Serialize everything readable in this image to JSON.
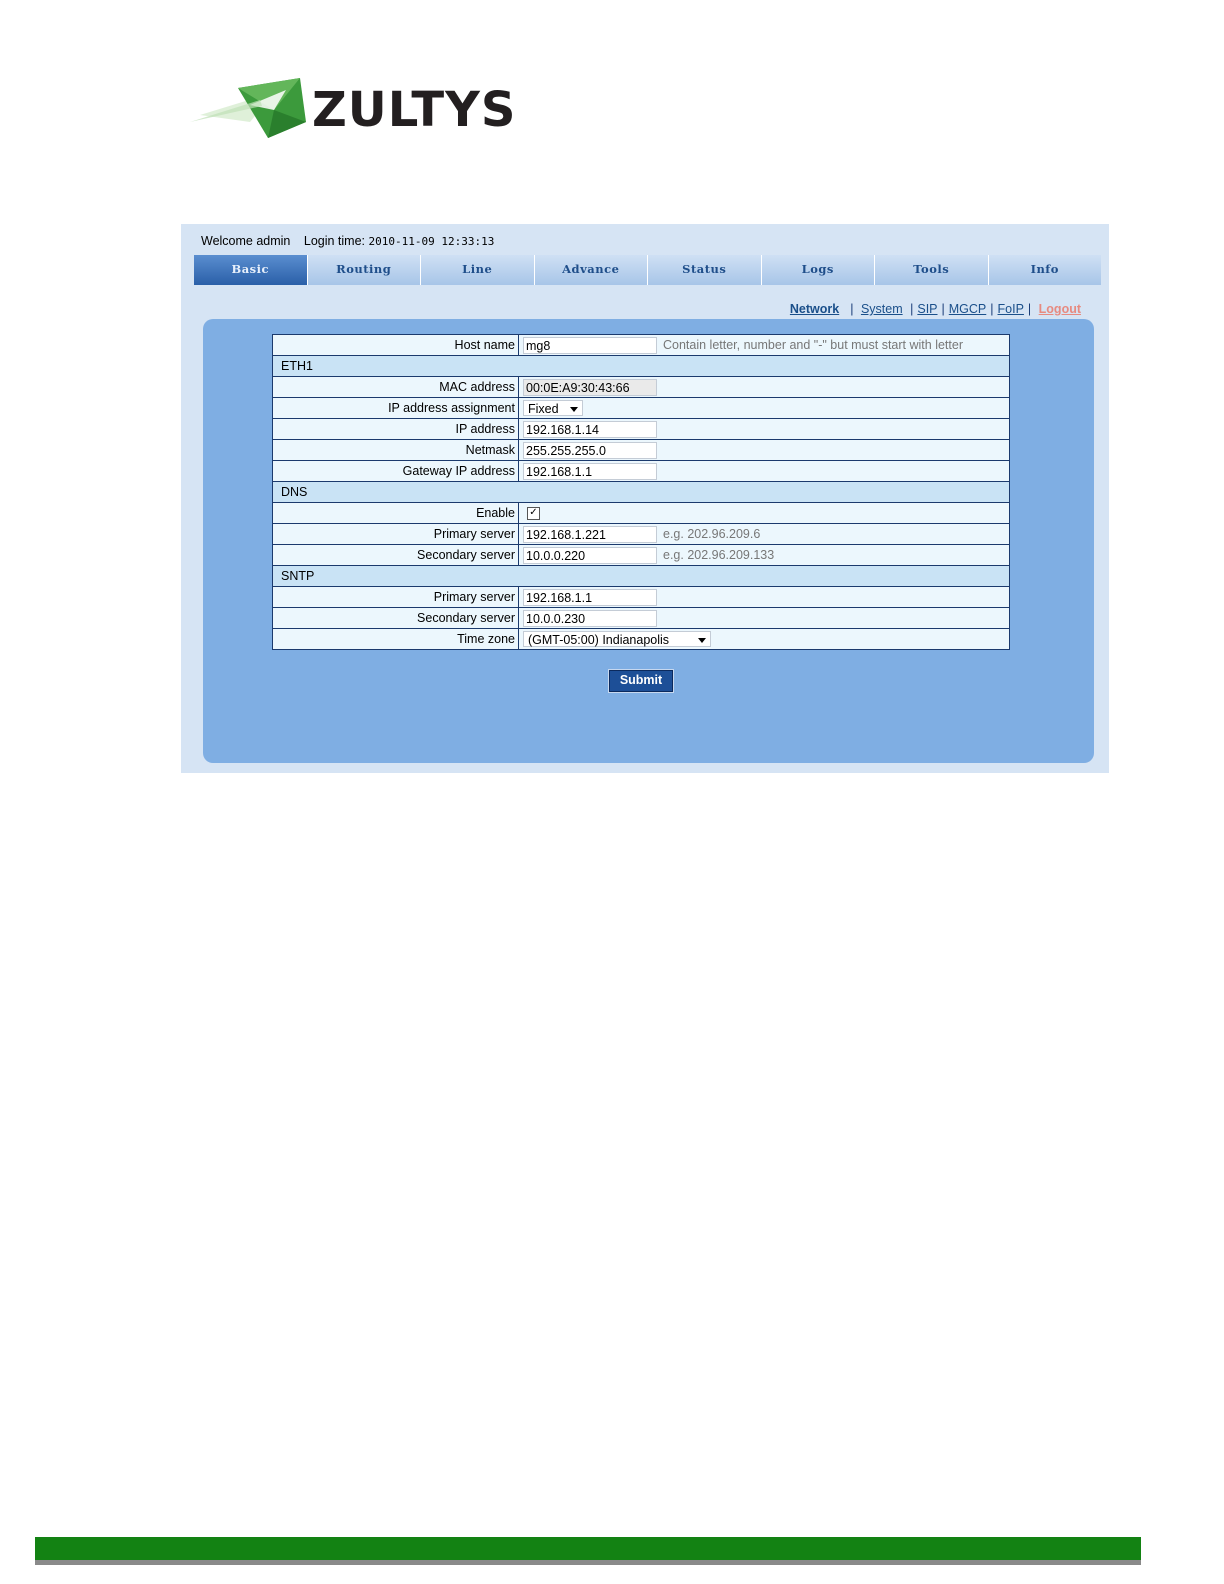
{
  "logo": {
    "text": "ZULTYS",
    "icon": "zultys-leaf-logo"
  },
  "header": {
    "welcome_label": "Welcome admin",
    "login_label": "Login time:",
    "login_time": "2010-11-09 12:33:13"
  },
  "tabs": [
    {
      "label": "Basic",
      "active": true
    },
    {
      "label": "Routing"
    },
    {
      "label": "Line"
    },
    {
      "label": "Advance"
    },
    {
      "label": "Status"
    },
    {
      "label": "Logs"
    },
    {
      "label": "Tools"
    },
    {
      "label": "Info"
    }
  ],
  "subnav": {
    "network": "Network",
    "system": "System",
    "sip": "SIP",
    "mgcp": "MGCP",
    "foip": "FoIP",
    "logout": "Logout"
  },
  "form": {
    "host_name": {
      "label": "Host name",
      "value": "mg8",
      "hint": "Contain letter, number and \"-\" but must start with letter"
    },
    "eth1": {
      "title": "ETH1",
      "mac": {
        "label": "MAC address",
        "value": "00:0E:A9:30:43:66"
      },
      "ip_assignment": {
        "label": "IP address assignment",
        "value": "Fixed"
      },
      "ip": {
        "label": "IP address",
        "value": "192.168.1.14"
      },
      "netmask": {
        "label": "Netmask",
        "value": "255.255.255.0"
      },
      "gateway": {
        "label": "Gateway IP address",
        "value": "192.168.1.1"
      }
    },
    "dns": {
      "title": "DNS",
      "enable": {
        "label": "Enable",
        "checked": true,
        "mark": "✓"
      },
      "primary": {
        "label": "Primary server",
        "value": "192.168.1.221",
        "hint": "e.g. 202.96.209.6"
      },
      "secondary": {
        "label": "Secondary server",
        "value": "10.0.0.220",
        "hint": "e.g. 202.96.209.133"
      }
    },
    "sntp": {
      "title": "SNTP",
      "primary": {
        "label": "Primary server",
        "value": "192.168.1.1"
      },
      "secondary": {
        "label": "Secondary server",
        "value": "10.0.0.230"
      },
      "timezone": {
        "label": "Time zone",
        "value": "(GMT-05:00) Indianapolis"
      }
    },
    "submit_label": "Submit"
  },
  "colors": {
    "footer_bar": "#138213",
    "panel_bg": "#d6e4f4",
    "content_bg": "#7faee3",
    "active_tab": "#2a5fa8",
    "logout_link": "#e78a80"
  }
}
